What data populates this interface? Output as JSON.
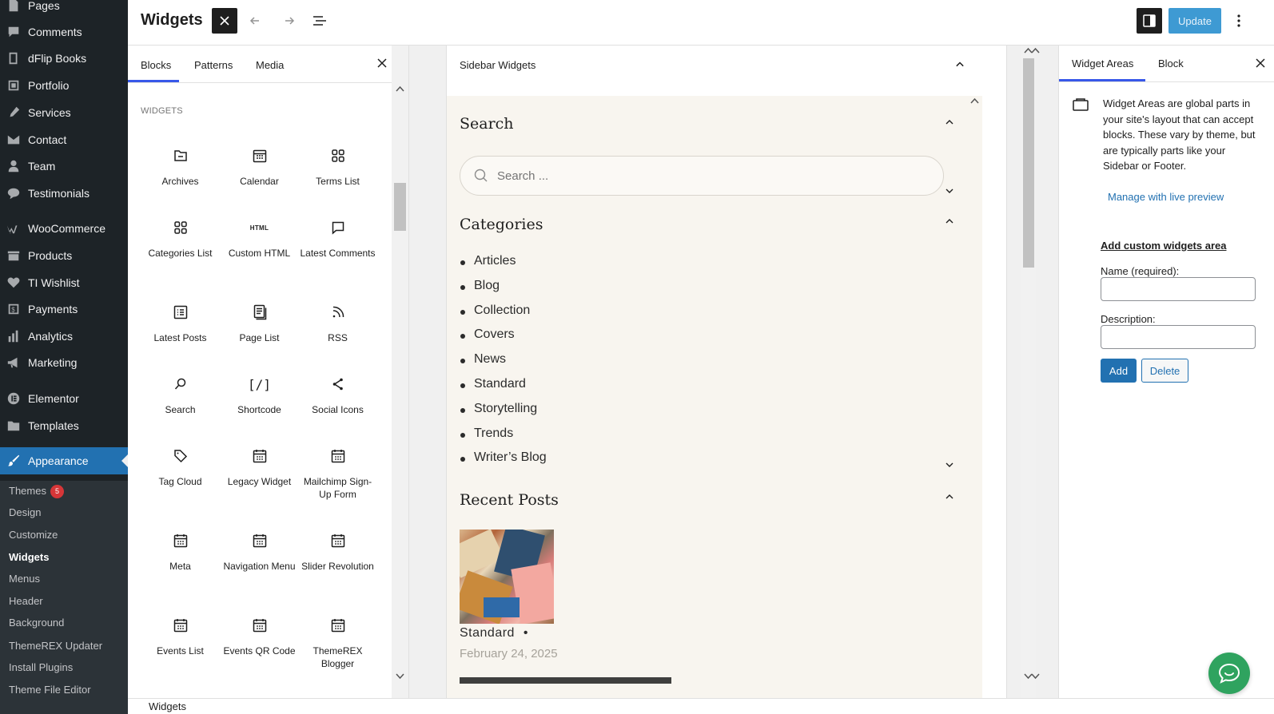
{
  "admin_menu": {
    "items": [
      {
        "label": "Pages",
        "icon": "pages-icon"
      },
      {
        "label": "Comments",
        "icon": "comments-icon"
      },
      {
        "label": "dFlip Books",
        "icon": "book-icon"
      },
      {
        "label": "Portfolio",
        "icon": "portfolio-icon"
      },
      {
        "label": "Services",
        "icon": "services-icon"
      },
      {
        "label": "Contact",
        "icon": "mail-icon"
      },
      {
        "label": "Team",
        "icon": "user-icon"
      },
      {
        "label": "Testimonials",
        "icon": "testimonials-icon"
      },
      {
        "label": "WooCommerce",
        "icon": "woocommerce-icon"
      },
      {
        "label": "Products",
        "icon": "products-icon"
      },
      {
        "label": "TI Wishlist",
        "icon": "heart-icon"
      },
      {
        "label": "Payments",
        "icon": "payments-icon"
      },
      {
        "label": "Analytics",
        "icon": "analytics-icon"
      },
      {
        "label": "Marketing",
        "icon": "megaphone-icon"
      },
      {
        "label": "Elementor",
        "icon": "elementor-icon"
      },
      {
        "label": "Templates",
        "icon": "folder-icon"
      },
      {
        "label": "Appearance",
        "icon": "paintbrush-icon"
      }
    ],
    "submenu": [
      {
        "label": "Themes",
        "badge": "5"
      },
      {
        "label": "Design"
      },
      {
        "label": "Customize"
      },
      {
        "label": "Widgets"
      },
      {
        "label": "Menus"
      },
      {
        "label": "Header"
      },
      {
        "label": "Background"
      },
      {
        "label": "ThemeREX Updater"
      },
      {
        "label": "Install Plugins"
      },
      {
        "label": "Theme File Editor"
      }
    ]
  },
  "header": {
    "title": "Widgets",
    "update_label": "Update"
  },
  "inserter": {
    "tabs": [
      "Blocks",
      "Patterns",
      "Media"
    ],
    "section_heading": "Widgets",
    "blocks": [
      {
        "label": "Archives",
        "icon": "archive-icon"
      },
      {
        "label": "Calendar",
        "icon": "calendar-icon"
      },
      {
        "label": "Terms List",
        "icon": "grid-icon"
      },
      {
        "label": "Categories List",
        "icon": "grid-icon"
      },
      {
        "label": "Custom HTML",
        "icon": "html-icon",
        "icon_text": "HTML"
      },
      {
        "label": "Latest Comments",
        "icon": "comment-icon"
      },
      {
        "label": "Latest Posts",
        "icon": "post-list-icon"
      },
      {
        "label": "Page List",
        "icon": "pages-icon"
      },
      {
        "label": "RSS",
        "icon": "rss-icon"
      },
      {
        "label": "Search",
        "icon": "search-icon"
      },
      {
        "label": "Shortcode",
        "icon": "shortcode-icon",
        "icon_text": "[/]"
      },
      {
        "label": "Social Icons",
        "icon": "share-icon"
      },
      {
        "label": "Tag Cloud",
        "icon": "tag-icon"
      },
      {
        "label": "Legacy Widget",
        "icon": "widget-icon"
      },
      {
        "label": "Mailchimp Sign-Up Form",
        "icon": "widget-icon"
      },
      {
        "label": "Meta",
        "icon": "widget-icon"
      },
      {
        "label": "Navigation Menu",
        "icon": "widget-icon"
      },
      {
        "label": "Slider Revolution",
        "icon": "widget-icon"
      },
      {
        "label": "Events List",
        "icon": "widget-icon"
      },
      {
        "label": "Events QR Code",
        "icon": "widget-icon"
      },
      {
        "label": "ThemeREX Blogger",
        "icon": "widget-icon"
      }
    ]
  },
  "canvas": {
    "area_title": "Sidebar Widgets",
    "search_heading": "Search",
    "search_placeholder": "Search ...",
    "categories_heading": "Categories",
    "categories": [
      "Articles",
      "Blog",
      "Collection",
      "Covers",
      "News",
      "Standard",
      "Storytelling",
      "Trends",
      "Writer’s Blog"
    ],
    "recent_heading": "Recent Posts",
    "post": {
      "category": "Standard",
      "separator": "•",
      "date": "February 24, 2025"
    }
  },
  "settings": {
    "tabs": [
      "Widget Areas",
      "Block"
    ],
    "description": "Widget Areas are global parts in your site's layout that can accept blocks. These vary by theme, but are typically parts like your Sidebar or Footer.",
    "manage_link": "Manage with live preview",
    "add_area_title": "Add custom widgets area",
    "name_label": "Name (required):",
    "description_label": "Description:",
    "add_label": "Add",
    "delete_label": "Delete"
  },
  "footer": {
    "breadcrumb": "Widgets"
  },
  "colors": {
    "admin_bg": "#1d2327",
    "accent": "#2271b1",
    "editor_accent": "#3858e9",
    "chat": "#2fa35f"
  }
}
